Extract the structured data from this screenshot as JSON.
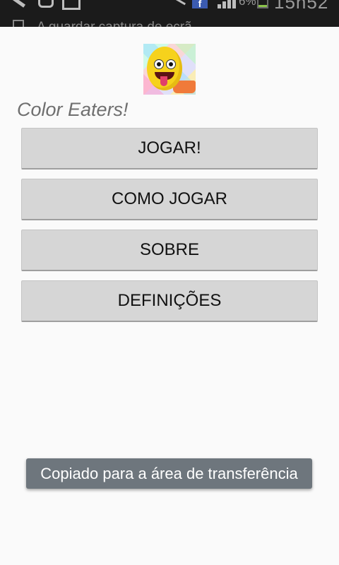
{
  "status_bar": {
    "icons": [
      "wrench-icon",
      "sync-icon",
      "image-icon",
      "mute-icon",
      "facebook-icon",
      "signal-icon",
      "battery-icon"
    ],
    "facebook_glyph": "f",
    "battery_percent": "6%",
    "time": "15h52"
  },
  "notification": {
    "ticker_text": "A guardar captura de ecrã..."
  },
  "app": {
    "logo_icon": "smiley-face-icon",
    "title": "Color Eaters!",
    "buttons": {
      "play": "JOGAR!",
      "how_to_play": "COMO JOGAR",
      "about": "SOBRE",
      "settings": "DEFINIÇÕES"
    }
  },
  "toast": {
    "message": "Copiado para a área de transferência"
  },
  "colors": {
    "background": "#fafafa",
    "button": "#d6d6d6",
    "toast": "#6e767d",
    "title": "#6f6f6f",
    "status_bar": "#1b1b1b"
  }
}
